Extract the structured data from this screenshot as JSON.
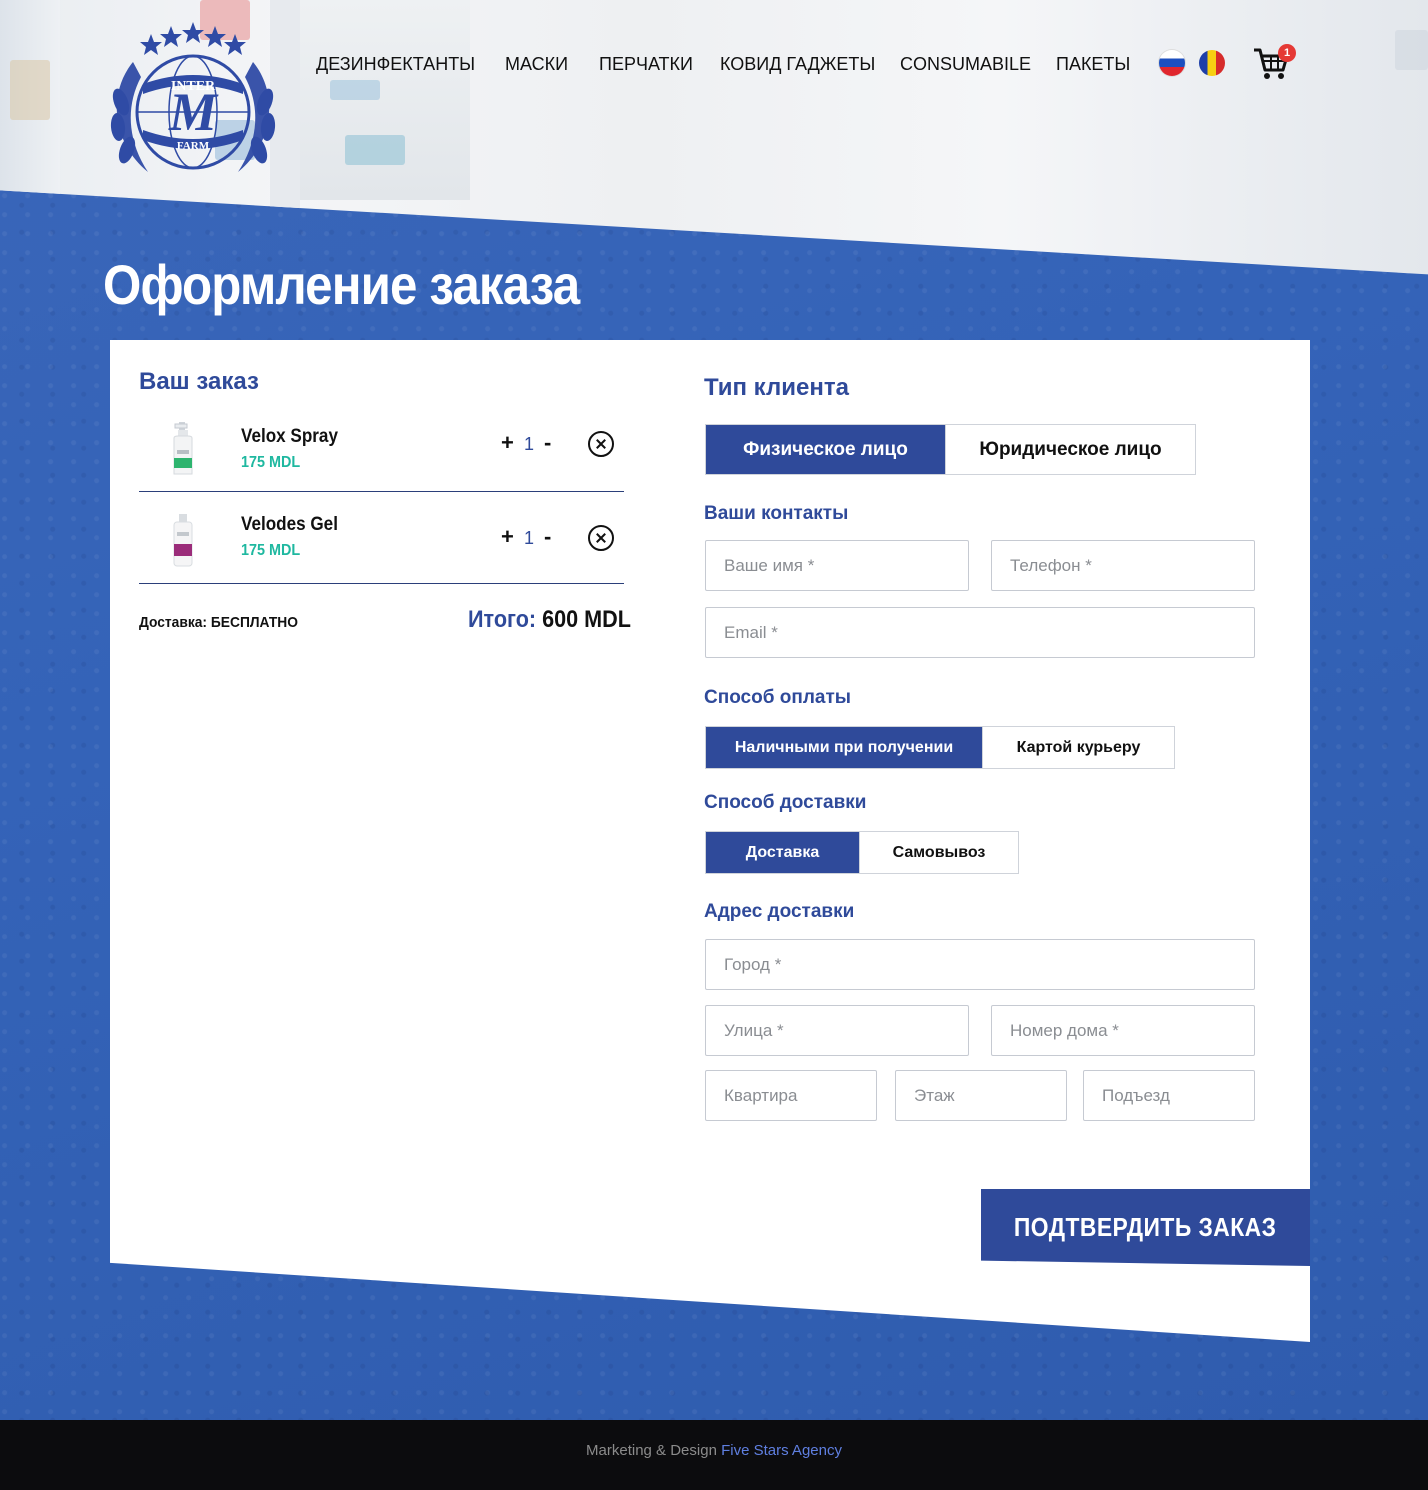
{
  "nav": {
    "items": [
      {
        "label": "ДЕЗИНФЕКТАНТЫ"
      },
      {
        "label": "МАСКИ"
      },
      {
        "label": "ПЕРЧАТКИ"
      },
      {
        "label": "КОВИД ГАДЖЕТЫ"
      },
      {
        "label": "CONSUMABILE"
      },
      {
        "label": "ПАКЕТЫ"
      }
    ],
    "languages": [
      "ru-flag-icon",
      "ro-flag-icon"
    ],
    "cart_count": "1"
  },
  "logo": {
    "top_text": "INTER",
    "letter": "M",
    "bottom_text": "FARM"
  },
  "page_title": "Оформление заказа",
  "order": {
    "title": "Ваш заказ",
    "items": [
      {
        "name": "Velox Spray",
        "price": "175 MDL",
        "qty": "1",
        "plus": "+",
        "minus": "-"
      },
      {
        "name": "Velodes Gel",
        "price": "175 MDL",
        "qty": "1",
        "plus": "+",
        "minus": "-"
      }
    ],
    "delivery_label": "Доставка:",
    "delivery_value": "БЕСПЛАТНО",
    "total_label": "Итого:",
    "total_value": "600 MDL"
  },
  "form": {
    "client_type_title": "Тип клиента",
    "client_types": [
      "Физическое лицо",
      "Юридическое лицо"
    ],
    "contacts_title": "Ваши контакты",
    "name_placeholder": "Ваше имя *",
    "phone_placeholder": "Телефон *",
    "email_placeholder": "Email *",
    "payment_title": "Способ оплаты",
    "payment_options": [
      "Наличными при получении",
      "Картой курьеру"
    ],
    "delivery_title": "Способ доставки",
    "delivery_options": [
      "Доставка",
      "Самовывоз"
    ],
    "address_title": "Адрес доставки",
    "city_placeholder": "Город *",
    "street_placeholder": "Улица *",
    "house_placeholder": "Номер дома *",
    "apartment_placeholder": "Квартира",
    "floor_placeholder": "Этаж",
    "entrance_placeholder": "Подъезд",
    "submit_label": "ПОДТВЕРДИТЬ ЗАКАЗ"
  },
  "footer": {
    "text": "Marketing & Design ",
    "link": "Five Stars Agency"
  },
  "colors": {
    "brand_blue": "#2f4a9a",
    "background_blue": "#3561b5",
    "price_green": "#1fb8a0",
    "badge_red": "#e53935"
  }
}
